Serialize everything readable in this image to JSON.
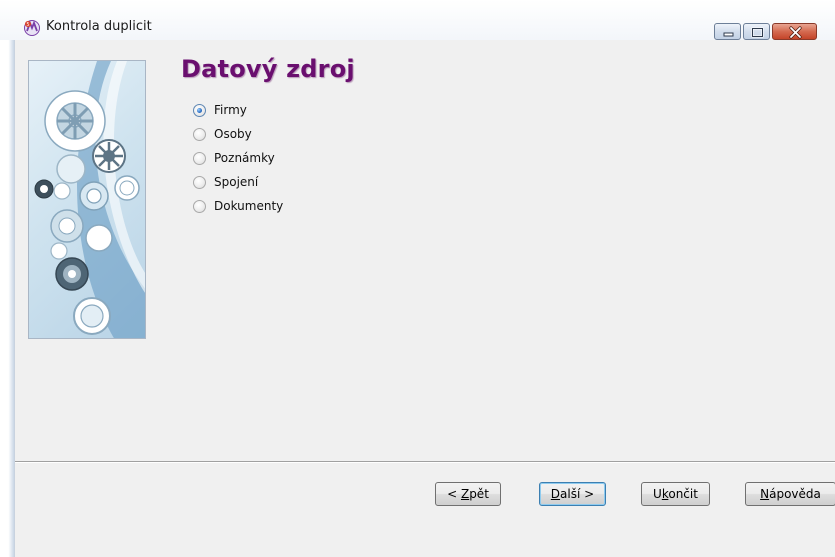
{
  "window": {
    "title": "Kontrola duplicit"
  },
  "wizard": {
    "heading": "Datový zdroj",
    "options": [
      {
        "label": "Firmy",
        "checked": true
      },
      {
        "label": "Osoby",
        "checked": false
      },
      {
        "label": "Poznámky",
        "checked": false
      },
      {
        "label": "Spojení",
        "checked": false
      },
      {
        "label": "Dokumenty",
        "checked": false
      }
    ]
  },
  "buttons": {
    "back": {
      "prefix": "< ",
      "mnemonic": "Z",
      "rest": "pět"
    },
    "next": {
      "mnemonic": "D",
      "rest": "alší >"
    },
    "finish": {
      "prefix": "U",
      "mnemonic": "k",
      "rest": "ončit"
    },
    "help": {
      "mnemonic": "N",
      "rest": "ápověda"
    }
  },
  "colors": {
    "heading": "#6a0f6f",
    "client_bg": "#f0f0f0",
    "radio_selected": "#2c6fc4",
    "close_button": "#c4452a"
  },
  "icons": {
    "app": "gears-app-icon",
    "banner": "gears-illustration"
  }
}
